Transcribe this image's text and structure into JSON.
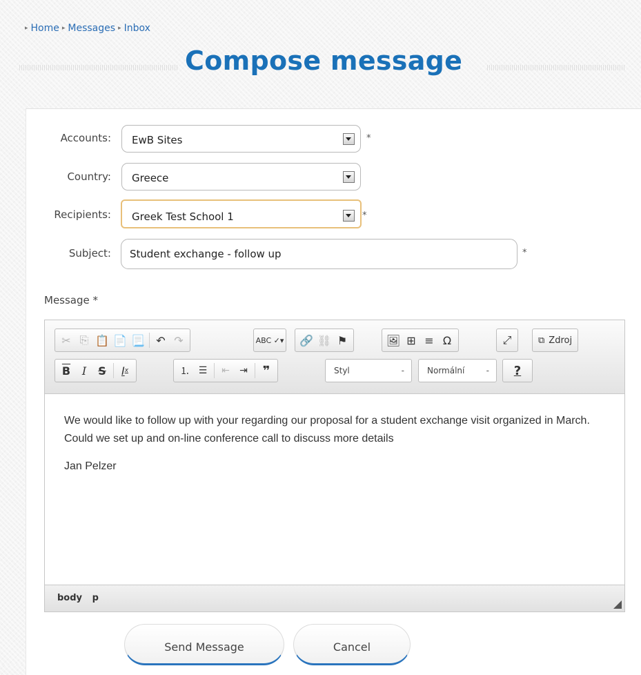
{
  "breadcrumb": {
    "items": [
      "Home",
      "Messages",
      "Inbox"
    ]
  },
  "page_title": "Compose message",
  "form": {
    "accounts": {
      "label": "Accounts:",
      "value": "EwB Sites",
      "required": "*"
    },
    "country": {
      "label": "Country:",
      "value": "Greece"
    },
    "recipients": {
      "label": "Recipients:",
      "value": "Greek Test School 1",
      "required": "*"
    },
    "subject": {
      "label": "Subject:",
      "value": "Student exchange - follow up",
      "required": "*"
    },
    "message_label": "Message *"
  },
  "editor": {
    "toolbar": {
      "style_combo": "Styl",
      "format_combo": "Normální",
      "source_label": "Zdroj",
      "combo_arrow": "-",
      "help_label": "?",
      "abc_label": "ABC"
    },
    "content": {
      "paragraph1": "We would like  to follow up  with your regarding our proposal for a student exchange visit organized in March. Could  we set up and on-line conference call to discuss more details",
      "paragraph2": "Jan Pelzer"
    },
    "status_path": [
      "body",
      "p"
    ]
  },
  "buttons": {
    "send": "Send Message",
    "cancel": "Cancel"
  }
}
